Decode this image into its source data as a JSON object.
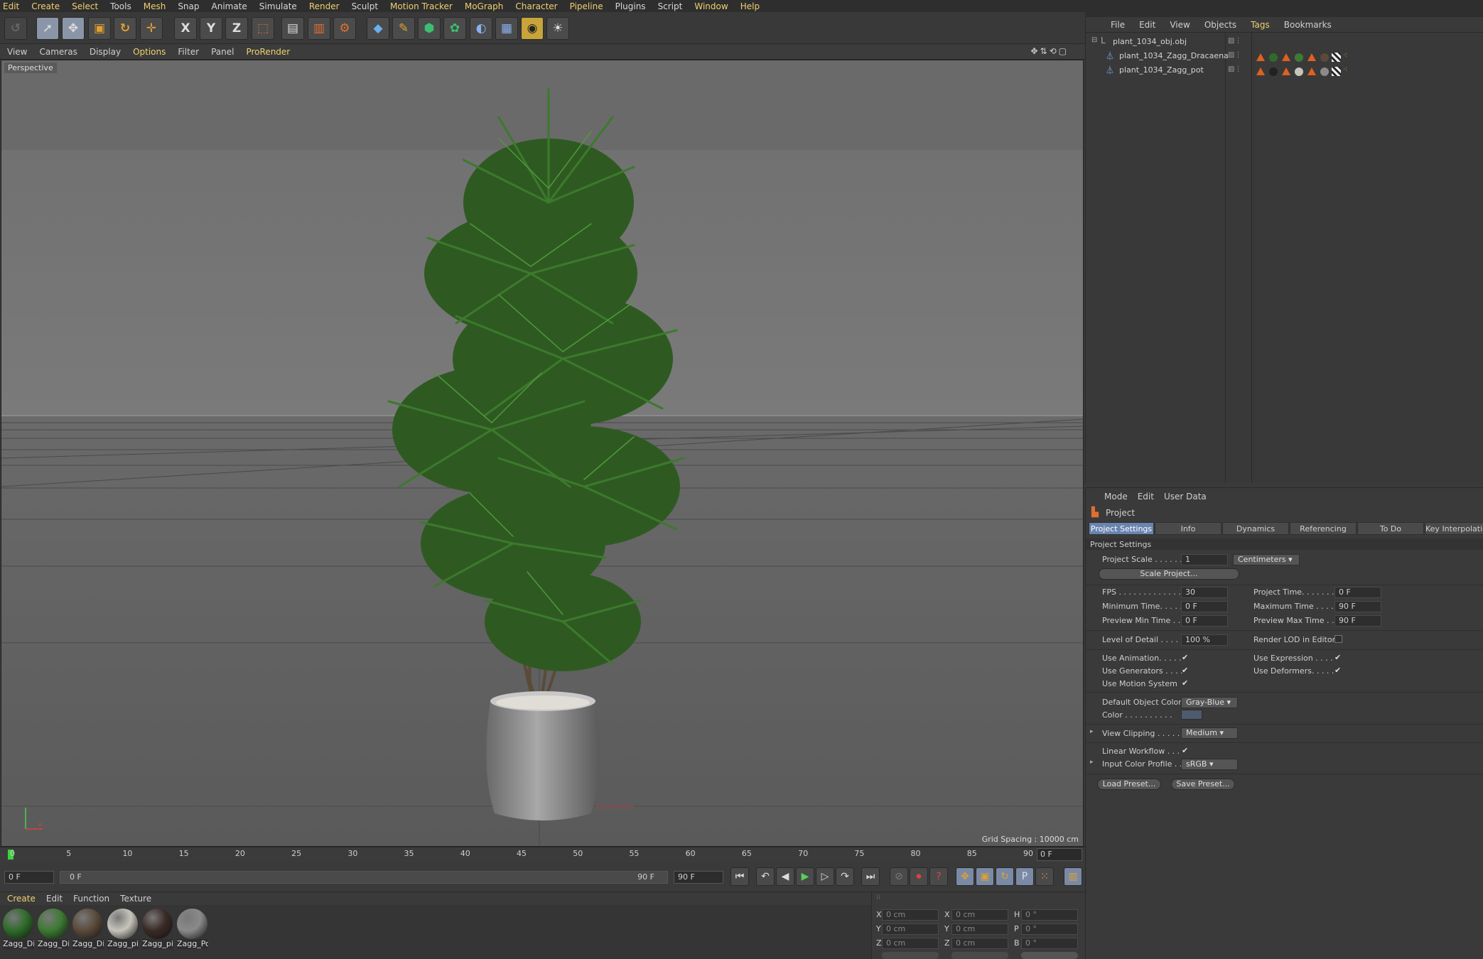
{
  "menubar": [
    "Edit",
    "Create",
    "Select",
    "Tools",
    "Mesh",
    "Snap",
    "Animate",
    "Simulate",
    "Render",
    "Sculpt",
    "Motion Tracker",
    "MoGraph",
    "Character",
    "Pipeline",
    "Plugins",
    "Script",
    "Window",
    "Help"
  ],
  "toolbar": {
    "axis_x": "X",
    "axis_y": "Y",
    "axis_z": "Z"
  },
  "viewport": {
    "menu": [
      "View",
      "Cameras",
      "Display",
      "Options",
      "Filter",
      "Panel",
      "ProRender"
    ],
    "label": "Perspective",
    "grid_spacing": "Grid Spacing : 10000 cm"
  },
  "timeline": {
    "ticks": [
      "0",
      "5",
      "10",
      "15",
      "20",
      "25",
      "30",
      "35",
      "40",
      "45",
      "50",
      "55",
      "60",
      "65",
      "70",
      "75",
      "80",
      "85",
      "90"
    ],
    "current_frame": "0 F",
    "start_field": "0 F",
    "slider_start": "0 F",
    "slider_end": "90 F",
    "end_field": "90 F"
  },
  "materials": {
    "menu": [
      "Create",
      "Edit",
      "Function",
      "Texture"
    ],
    "items": [
      {
        "name": "Zagg_Di",
        "color": "#2f6b2a"
      },
      {
        "name": "Zagg_Di",
        "color": "#3d7a32"
      },
      {
        "name": "Zagg_Di",
        "color": "#5a4a3a"
      },
      {
        "name": "Zagg_pi",
        "color": "#c8c4bc"
      },
      {
        "name": "Zagg_pi",
        "color": "#3a2a26"
      },
      {
        "name": "Zagg_Po",
        "color": "#8a8a8a"
      }
    ]
  },
  "coords": {
    "rows": [
      {
        "a": "X",
        "av": "0 cm",
        "b": "X",
        "bv": "0 cm",
        "c": "H",
        "cv": "0 °"
      },
      {
        "a": "Y",
        "av": "0 cm",
        "b": "Y",
        "bv": "0 cm",
        "c": "P",
        "cv": "0 °"
      },
      {
        "a": "Z",
        "av": "0 cm",
        "b": "Z",
        "bv": "0 cm",
        "c": "B",
        "cv": "0 °"
      }
    ]
  },
  "objects": {
    "menu": [
      "File",
      "Edit",
      "View",
      "Objects",
      "Tags",
      "Bookmarks"
    ],
    "items": [
      "plant_1034_obj.obj",
      "plant_1034_Zagg_Dracaena",
      "plant_1034_Zagg_pot"
    ]
  },
  "attributes": {
    "menu": [
      "Mode",
      "Edit",
      "User Data"
    ],
    "title": "Project",
    "tabs": [
      "Project Settings",
      "Info",
      "Dynamics",
      "Referencing",
      "To Do",
      "Key Interpolation"
    ],
    "section": "Project Settings",
    "project_scale_label": "Project Scale . . . . . .",
    "project_scale": "1",
    "scale_unit": "Centimeters",
    "scale_project_btn": "Scale Project...",
    "fps_label": "FPS . . . . . . . . . . . . . .",
    "fps": "30",
    "project_time_label": "Project Time. . . . . . . .",
    "project_time": "0 F",
    "min_time_label": "Minimum Time. . . . .",
    "min_time": "0 F",
    "max_time_label": "Maximum Time . . . . .",
    "max_time": "90 F",
    "prev_min_label": "Preview Min Time . .",
    "prev_min": "0 F",
    "prev_max_label": "Preview Max Time . . .",
    "prev_max": "90 F",
    "lod_label": "Level of Detail . . . . .",
    "lod": "100 %",
    "render_lod_label": "Render LOD in Editor",
    "use_anim_label": "Use Animation. . . . .",
    "use_expr_label": "Use Expression . . . .",
    "use_gen_label": "Use Generators . . . .",
    "use_def_label": "Use Deformers. . . . .",
    "use_motion_label": "Use Motion System",
    "def_color_label": "Default Object Color",
    "def_color": "Gray-Blue",
    "color_label": "Color . . . . . . . . . .",
    "view_clip_label": "View Clipping . . . . .",
    "view_clip": "Medium",
    "linear_label": "Linear Workflow . . .",
    "input_profile_label": "Input Color Profile . .",
    "input_profile": "sRGB",
    "load_btn": "Load Preset...",
    "save_btn": "Save Preset..."
  }
}
